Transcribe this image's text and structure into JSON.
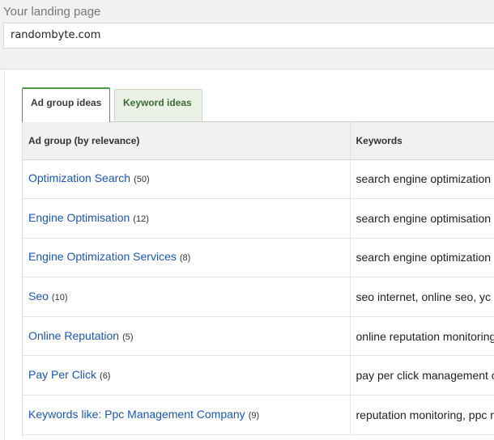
{
  "landing": {
    "label": "Your landing page",
    "url_value": "randombyte.com"
  },
  "tabs": [
    {
      "label": "Ad group ideas",
      "active": true
    },
    {
      "label": "Keyword ideas",
      "active": false
    }
  ],
  "table": {
    "headers": [
      "Ad group (by relevance)",
      "Keywords"
    ],
    "rows": [
      {
        "group": "Optimization Search",
        "count": "(50)",
        "keywords": "search engine optimization"
      },
      {
        "group": "Engine Optimisation",
        "count": "(12)",
        "keywords": "search engine optimisation"
      },
      {
        "group": "Engine Optimization Services",
        "count": "(8)",
        "keywords": "search engine optimization"
      },
      {
        "group": "Seo",
        "count": "(10)",
        "keywords": "seo internet, online seo, yc"
      },
      {
        "group": "Online Reputation",
        "count": "(5)",
        "keywords": "online reputation monitoring"
      },
      {
        "group": "Pay Per Click",
        "count": "(6)",
        "keywords": "pay per click management c"
      },
      {
        "group": "Keywords like: Ppc Management Company",
        "count": "(9)",
        "keywords": "reputation monitoring, ppc m"
      }
    ]
  },
  "colors": {
    "link": "#1a57b3",
    "active_tab_accent": "#4b9b44",
    "inactive_tab_bg": "#eaf1e6"
  }
}
